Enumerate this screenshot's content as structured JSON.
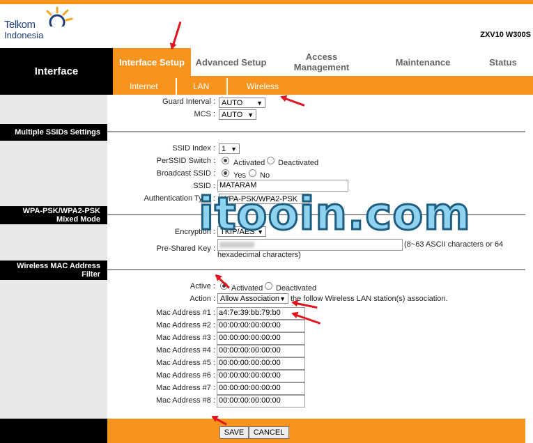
{
  "header": {
    "logo_line1": "Telkom",
    "logo_line2": "Indonesia",
    "model": "ZXV10 W300S"
  },
  "nav": {
    "side_title": "Interface",
    "tabs": [
      "Interface Setup",
      "Advanced Setup",
      "Access Management",
      "Maintenance",
      "Status"
    ],
    "active_tab": "Interface Setup",
    "subtabs": [
      "Internet",
      "LAN",
      "Wireless"
    ],
    "active_subtab": "Wireless"
  },
  "top_fields": {
    "guard_interval_label": "Guard Interval :",
    "guard_interval_value": "AUTO",
    "mcs_label": "MCS :",
    "mcs_value": "AUTO"
  },
  "ssid_section": {
    "title": "Multiple SSIDs Settings",
    "ssid_index_label": "SSID Index :",
    "ssid_index_value": "1",
    "perssid_label": "PerSSID Switch :",
    "perssid_on": "Activated",
    "perssid_off": "Deactivated",
    "broadcast_label": "Broadcast SSID :",
    "broadcast_yes": "Yes",
    "broadcast_no": "No",
    "ssid_label": "SSID :",
    "ssid_value": "MATARAM",
    "auth_label": "Authentication Type :",
    "auth_value": "WPA-PSK/WPA2-PSK"
  },
  "wpa_section": {
    "title": "WPA-PSK/WPA2-PSK Mixed Mode",
    "encryption_label": "Encryption :",
    "encryption_value": "TKIP/AES",
    "psk_label": "Pre-Shared Key :",
    "psk_value": "",
    "psk_hint1": "(8~63 ASCII characters or 64",
    "psk_hint2": "hexadecimal characters)"
  },
  "mac_section": {
    "title": "Wireless MAC Address Filter",
    "active_label": "Active :",
    "active_on": "Activated",
    "active_off": "Deactivated",
    "action_label": "Action :",
    "action_value": "Allow Association",
    "action_hint": "the follow Wireless LAN station(s) association.",
    "macs": [
      {
        "label": "Mac Address #1 :",
        "value": "a4:7e:39:bb:79:b0"
      },
      {
        "label": "Mac Address #2 :",
        "value": "00:00:00:00:00:00"
      },
      {
        "label": "Mac Address #3 :",
        "value": "00:00:00:00:00:00"
      },
      {
        "label": "Mac Address #4 :",
        "value": "00:00:00:00:00:00"
      },
      {
        "label": "Mac Address #5 :",
        "value": "00:00:00:00:00:00"
      },
      {
        "label": "Mac Address #6 :",
        "value": "00:00:00:00:00:00"
      },
      {
        "label": "Mac Address #7 :",
        "value": "00:00:00:00:00:00"
      },
      {
        "label": "Mac Address #8 :",
        "value": "00:00:00:00:00:00"
      }
    ]
  },
  "buttons": {
    "save": "SAVE",
    "cancel": "CANCEL"
  },
  "watermark": "itooin.com",
  "colors": {
    "accent": "#f7941d",
    "annotation": "#e0141e",
    "watermark_fill": "#8fd3ef"
  }
}
